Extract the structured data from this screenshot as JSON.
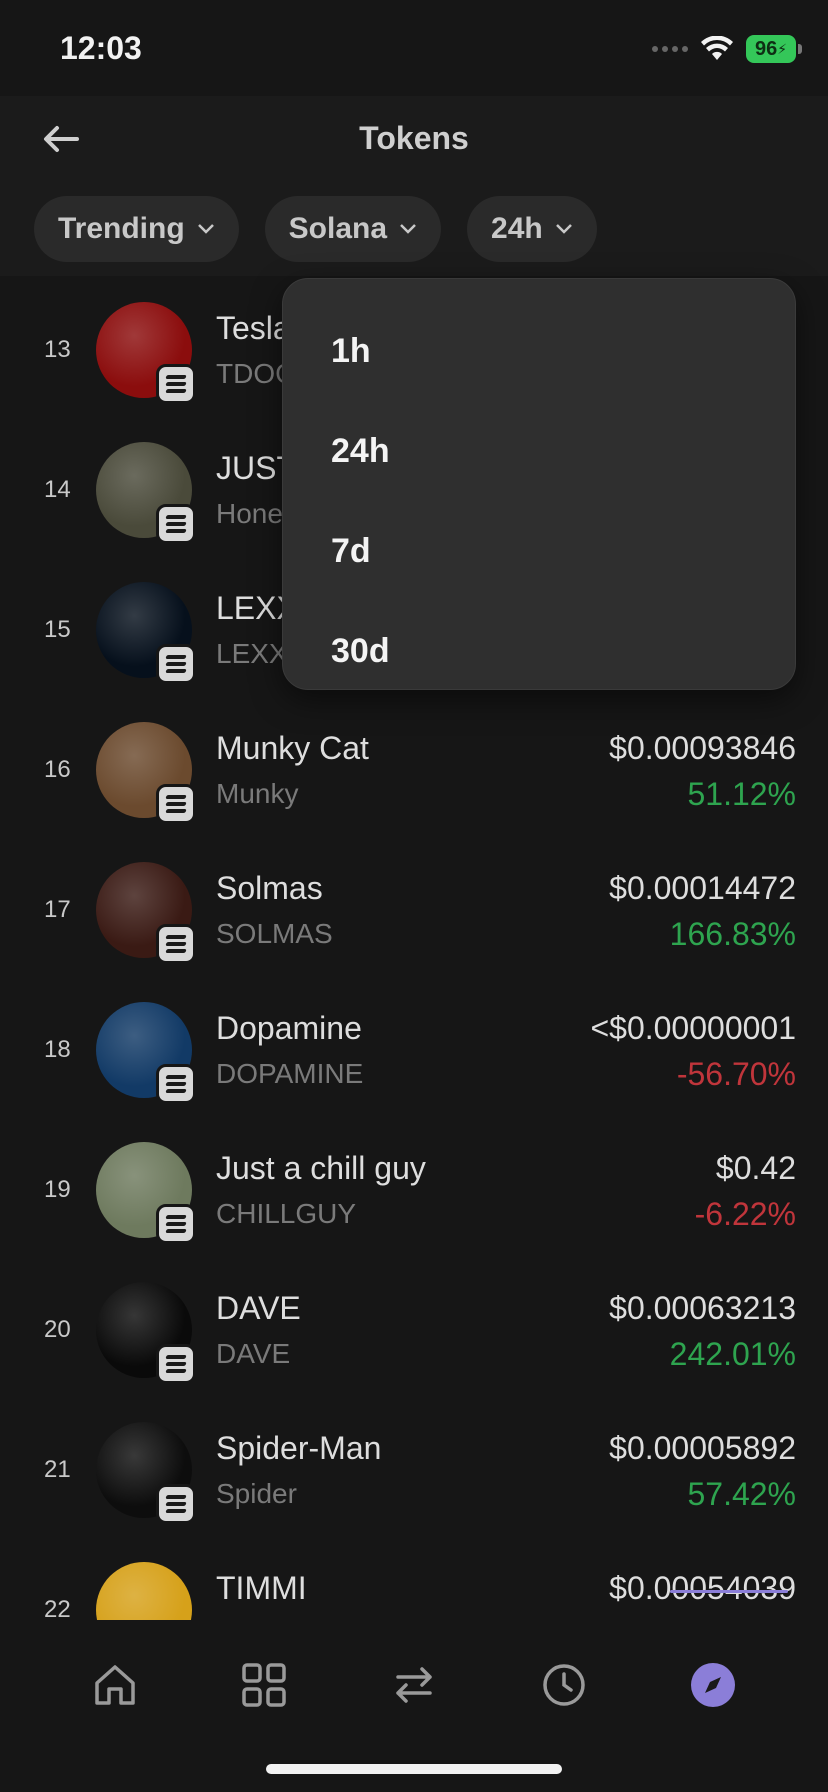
{
  "status_bar": {
    "time": "12:03",
    "battery": "96"
  },
  "header": {
    "title": "Tokens"
  },
  "filters": [
    {
      "label": "Trending"
    },
    {
      "label": "Solana"
    },
    {
      "label": "24h"
    }
  ],
  "dropdown": {
    "options": [
      "1h",
      "24h",
      "7d",
      "30d"
    ]
  },
  "tokens": [
    {
      "rank": "13",
      "name": "Tesla",
      "symbol": "TDOGE",
      "price": "",
      "change": "",
      "direction": "up",
      "avatar_color": "#8b0d0d",
      "avatar_icon": "tesla-logo"
    },
    {
      "rank": "14",
      "name": "JUST",
      "symbol": "Honey",
      "price": "",
      "change": "",
      "direction": "up",
      "avatar_color": "#4a4a3a",
      "avatar_icon": "bear"
    },
    {
      "rank": "15",
      "name": "LEXXI",
      "symbol": "LEXXI",
      "price": "",
      "change": "",
      "direction": "up",
      "avatar_color": "#06101c",
      "avatar_icon": "hologram-head"
    },
    {
      "rank": "16",
      "name": "Munky Cat",
      "symbol": "Munky",
      "price": "$0.00093846",
      "change": "51.12%",
      "direction": "up",
      "avatar_color": "#6b4a2e",
      "avatar_icon": "cat"
    },
    {
      "rank": "17",
      "name": "Solmas",
      "symbol": "SOLMAS",
      "price": "$0.00014472",
      "change": "166.83%",
      "direction": "up",
      "avatar_color": "#3a1a14",
      "avatar_icon": "santa-hat"
    },
    {
      "rank": "18",
      "name": "Dopamine",
      "symbol": "DOPAMINE",
      "price": "<$0.00000001",
      "change": "-56.70%",
      "direction": "down",
      "avatar_color": "#123a66",
      "avatar_icon": "molecule"
    },
    {
      "rank": "19",
      "name": "Just a chill guy",
      "symbol": "CHILLGUY",
      "price": "$0.42",
      "change": "-6.22%",
      "direction": "down",
      "avatar_color": "#6e7a5e",
      "avatar_icon": "dog"
    },
    {
      "rank": "20",
      "name": "DAVE",
      "symbol": "DAVE",
      "price": "$0.00063213",
      "change": "242.01%",
      "direction": "up",
      "avatar_color": "#0a0a0a",
      "avatar_icon": "smiley-figure"
    },
    {
      "rank": "21",
      "name": "Spider-Man",
      "symbol": "Spider",
      "price": "$0.00005892",
      "change": "57.42%",
      "direction": "up",
      "avatar_color": "#0d0d0d",
      "avatar_icon": "spider"
    },
    {
      "rank": "22",
      "name": "TIMMI",
      "symbol": "",
      "price": "$0.00054039",
      "change": "",
      "direction": "up",
      "avatar_color": "#d6a11a",
      "avatar_icon": "character"
    }
  ],
  "bottom_nav": [
    {
      "name": "home",
      "icon": "home-icon"
    },
    {
      "name": "apps",
      "icon": "grid-icon"
    },
    {
      "name": "swap",
      "icon": "swap-icon"
    },
    {
      "name": "activity",
      "icon": "clock-icon"
    },
    {
      "name": "explore",
      "icon": "compass-icon",
      "active": true
    }
  ],
  "colors": {
    "up": "#2ea44f",
    "down": "#c0353b",
    "accent": "#8b7ed8"
  }
}
